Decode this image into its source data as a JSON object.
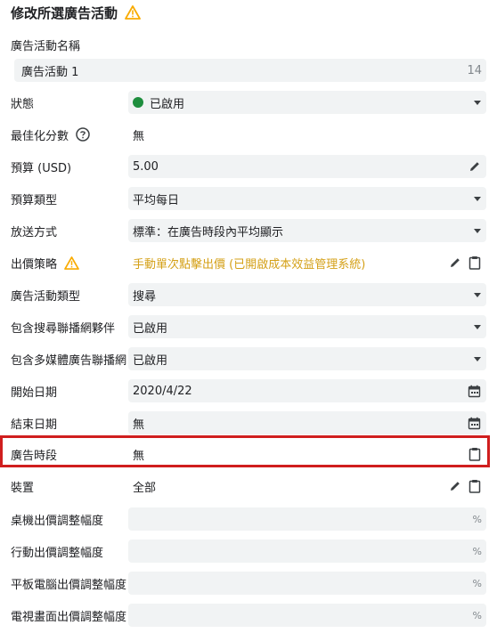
{
  "title": "修改所選廣告活動",
  "name_field": {
    "label": "廣告活動名稱",
    "value": "廣告活動 1",
    "counter": "14"
  },
  "rows": [
    {
      "label": "狀態",
      "value": "已啟用"
    },
    {
      "label": "最佳化分數",
      "value": "無"
    },
    {
      "label": "預算 (USD)",
      "value": "5.00"
    },
    {
      "label": "預算類型",
      "value": "平均每日"
    },
    {
      "label": "放送方式",
      "value": "標準：在廣告時段內平均顯示"
    },
    {
      "label": "出價策略",
      "value": "手動單次點擊出價 (已開啟成本效益管理系統)"
    },
    {
      "label": "廣告活動類型",
      "value": "搜尋"
    },
    {
      "label": "包含搜尋聯播網夥伴",
      "value": "已啟用"
    },
    {
      "label": "包含多媒體廣告聯播網",
      "value": "已啟用"
    },
    {
      "label": "開始日期",
      "value": "2020/4/22"
    },
    {
      "label": "結束日期",
      "value": "無"
    },
    {
      "label": "廣告時段",
      "value": "無"
    },
    {
      "label": "裝置",
      "value": "全部"
    },
    {
      "label": "桌機出價調整幅度",
      "suffix": "%"
    },
    {
      "label": "行動出價調整幅度",
      "suffix": "%"
    },
    {
      "label": "平板電腦出價調整幅度",
      "suffix": "%"
    },
    {
      "label": "電視畫面出價調整幅度",
      "suffix": "%"
    }
  ],
  "colors": {
    "status_enabled": "#1e8e3e",
    "warning": "#f9ab00",
    "bid_strategy_text": "#d4a017",
    "highlight_border": "#d01e1e",
    "field_bg": "#f1f3f4"
  }
}
